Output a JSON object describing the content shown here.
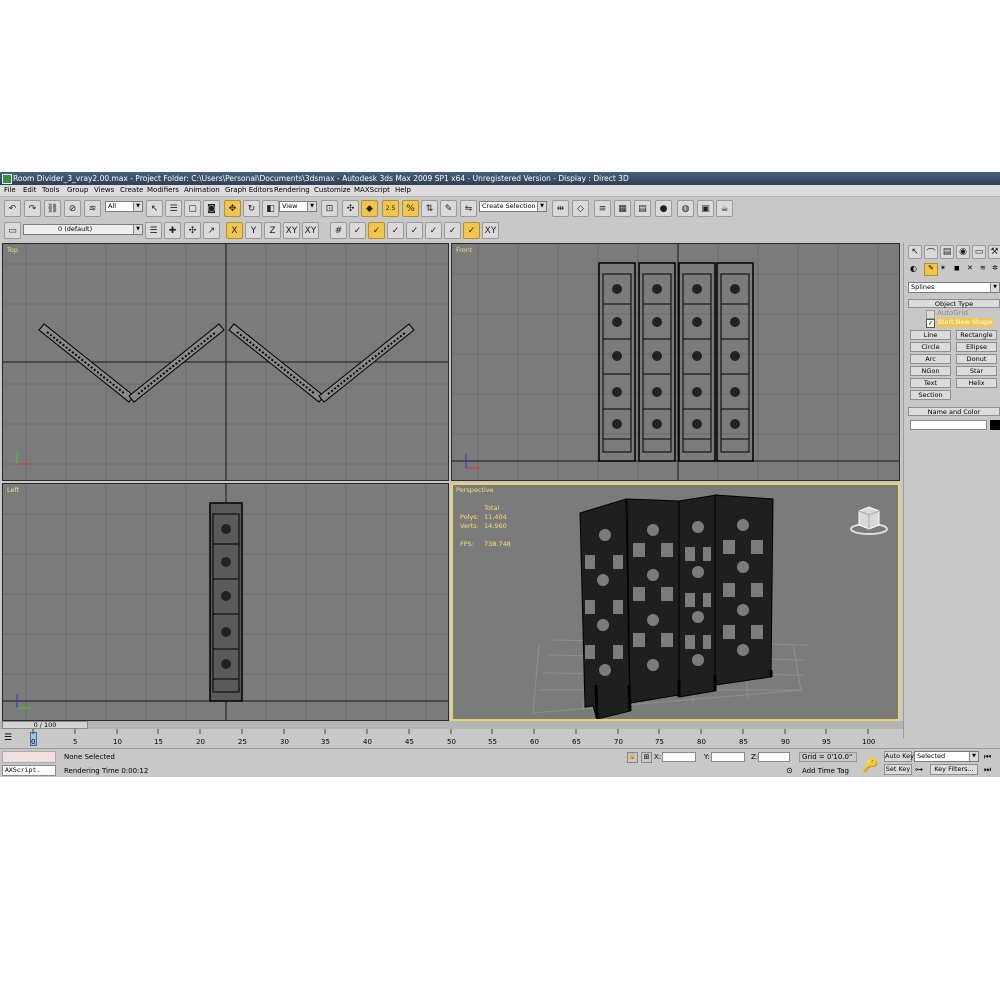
{
  "window": {
    "title": "Room Divider_3_vray2.00.max  - Project Folder: C:\\Users\\Personal\\Documents\\3dsmax    - Autodesk 3ds Max  2009 SP1  x64   - Unregistered Version       - Display : Direct 3D"
  },
  "menu": [
    "File",
    "Edit",
    "Tools",
    "Group",
    "Views",
    "Create",
    "Modifiers",
    "Animation",
    "Graph Editors",
    "Rendering",
    "Customize",
    "MAXScript",
    "Help"
  ],
  "toolbar": {
    "selection_filter": "All",
    "ref_coord": "View",
    "selection_set_placeholder": "Create Selection Set",
    "angle_snap_label": "2.5"
  },
  "layer_bar": {
    "layer_name": "0 (default)",
    "axis_constraints": [
      "X",
      "Y",
      "Z",
      "XY",
      "XY"
    ]
  },
  "viewports": {
    "top": "Top",
    "front": "Front",
    "left": "Left",
    "perspective": "Perspective"
  },
  "stats": {
    "header": "Total",
    "polys_label": "Polys:",
    "polys_value": "11,404",
    "verts_label": "Verts:",
    "verts_value": "14,960",
    "fps_label": "FPS:",
    "fps_value": "738.748"
  },
  "command_panel": {
    "category": "Splines",
    "object_type_title": "Object Type",
    "autogrid": "AutoGrid",
    "start_new_shape": "Start New Shape",
    "buttons": [
      "Line",
      "Rectangle",
      "Circle",
      "Ellipse",
      "Arc",
      "Donut",
      "NGon",
      "Star",
      "Text",
      "Helix",
      "Section"
    ],
    "name_color_title": "Name and Color"
  },
  "timeline": {
    "frame_indicator": "0 / 100",
    "ticks": [
      "0",
      "5",
      "10",
      "15",
      "20",
      "25",
      "30",
      "35",
      "40",
      "45",
      "50",
      "55",
      "60",
      "65",
      "70",
      "75",
      "80",
      "85",
      "90",
      "95",
      "100"
    ]
  },
  "status": {
    "maxscript": "AXScript.",
    "selection": "None Selected",
    "render_time": "Rendering Time  0:00:12",
    "x_label": "X:",
    "y_label": "Y:",
    "z_label": "Z:",
    "grid": "Grid = 0'10.0\"",
    "add_time_tag": "Add Time Tag",
    "auto_key": "Auto Key",
    "auto_key_mode": "Selected",
    "set_key": "Set Key",
    "key_filters": "Key Filters..."
  }
}
